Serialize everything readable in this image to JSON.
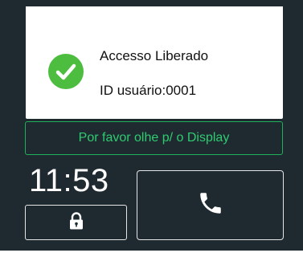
{
  "status": {
    "icon": "check-circle-icon",
    "title": "Accesso Liberado",
    "user_id": "ID usuário:0001"
  },
  "banner": {
    "text": "Por favor olhe p/ o Display"
  },
  "clock": {
    "time": "11:53"
  },
  "buttons": {
    "lock_icon": "lock-icon",
    "call_icon": "phone-icon"
  },
  "colors": {
    "background": "#1f2a30",
    "accent_green": "#2ecc71",
    "check_green": "#4cbd3e"
  }
}
